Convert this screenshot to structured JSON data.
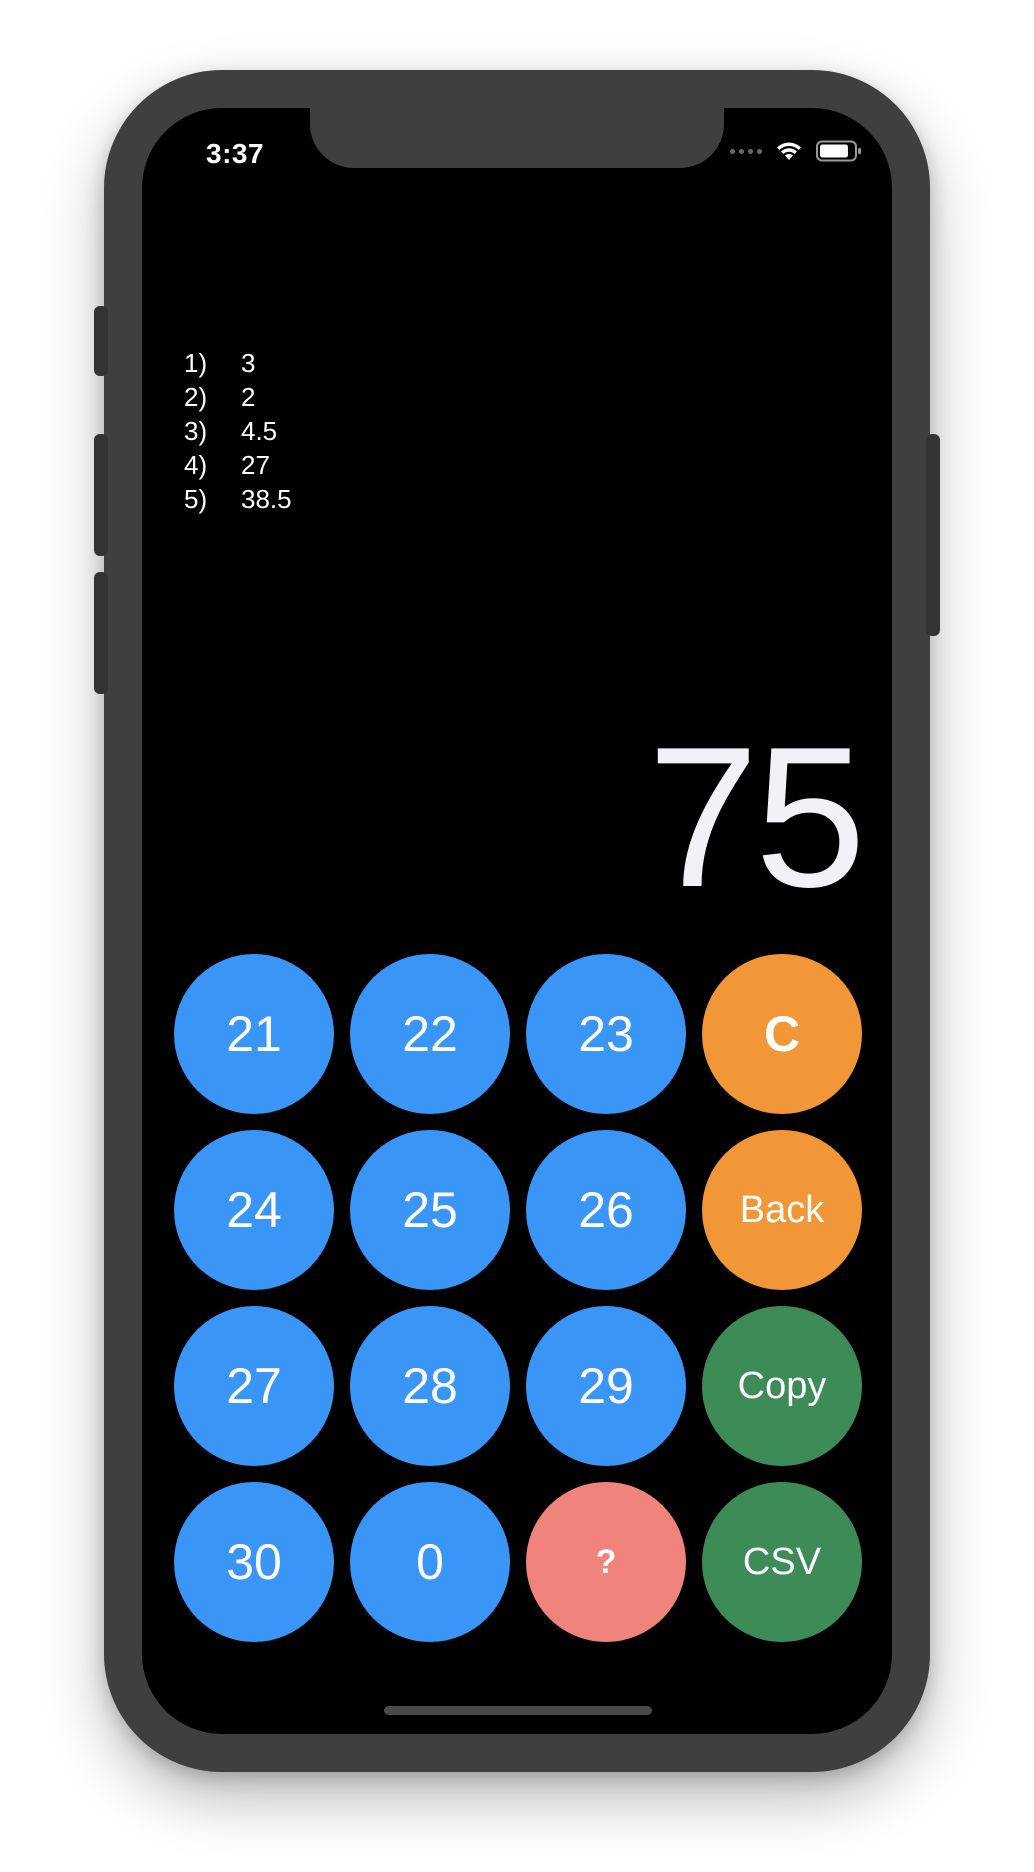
{
  "status_bar": {
    "time": "3:37"
  },
  "history": [
    {
      "index": "1)",
      "value": "3"
    },
    {
      "index": "2)",
      "value": "2"
    },
    {
      "index": "3)",
      "value": "4.5"
    },
    {
      "index": "4)",
      "value": "27"
    },
    {
      "index": "5)",
      "value": "38.5"
    }
  ],
  "display": {
    "value": "75"
  },
  "keypad": {
    "row1": [
      "21",
      "22",
      "23",
      "C"
    ],
    "row2": [
      "24",
      "25",
      "26",
      "Back"
    ],
    "row3": [
      "27",
      "28",
      "29",
      "Copy"
    ],
    "row4": [
      "30",
      "0",
      "?",
      "CSV"
    ]
  },
  "colors": {
    "number_key": "#3996f6",
    "clear_back_key": "#f29738",
    "copy_csv_key": "#3d8c58",
    "help_key": "#f0847c",
    "screen_background": "#000000"
  },
  "icons": [
    "wifi-icon",
    "battery-icon",
    "cellular-signal-icon"
  ]
}
